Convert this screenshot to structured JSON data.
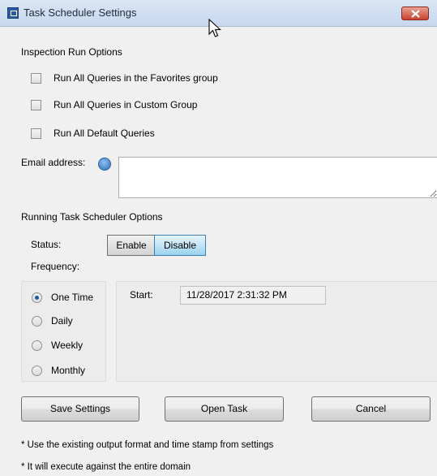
{
  "window": {
    "title": "Task Scheduler Settings",
    "icons": {
      "app": "app-icon",
      "close": "close-icon",
      "cursor": "mouse-pointer-icon"
    }
  },
  "inspection": {
    "heading": "Inspection Run Options",
    "options": [
      {
        "label": "Run All Queries in the Favorites group",
        "checked": false
      },
      {
        "label": "Run All Queries in Custom Group",
        "checked": false
      },
      {
        "label": "Run All Default Queries",
        "checked": false
      }
    ]
  },
  "email": {
    "label": "Email address:",
    "value": "",
    "help_icon": "help-icon"
  },
  "running": {
    "heading": "Running Task Scheduler Options",
    "status_label": "Status:",
    "enable_label": "Enable",
    "disable_label": "Disable",
    "selected_status": "Disable",
    "frequency_label": "Frequency:",
    "frequencies": [
      {
        "label": "One Time",
        "selected": true
      },
      {
        "label": "Daily",
        "selected": false
      },
      {
        "label": "Weekly",
        "selected": false
      },
      {
        "label": "Monthly",
        "selected": false
      }
    ],
    "start_label": "Start:",
    "start_value": "11/28/2017 2:31:32 PM"
  },
  "buttons": {
    "save": "Save Settings",
    "open": "Open Task",
    "cancel": "Cancel"
  },
  "notes": [
    "* Use the existing output format and time stamp from settings",
    "* It will execute against the entire domain"
  ],
  "colors": {
    "titlebar": "#c6d7ee",
    "close": "#c9452f",
    "selected_button": "#c4e5f6",
    "radio_dot": "#1c5c9a"
  }
}
